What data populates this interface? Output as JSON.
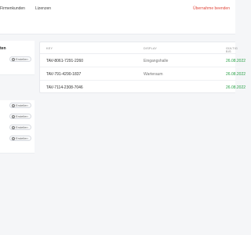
{
  "nav": {
    "firm_customers": "Firmenkunden",
    "licenses": "Lizenzen",
    "takeover": "Übernahme beenden"
  },
  "sidebar": {
    "title": "ten",
    "create_label": "Erstellen",
    "list_items": [
      {
        "label": "Erstellen"
      },
      {
        "label": "Erstellen"
      },
      {
        "label": "Erstellen"
      },
      {
        "label": "Erstellen"
      }
    ]
  },
  "table": {
    "headers": {
      "key": "KEY",
      "display": "DISPLAY",
      "valid": "GÜLTIG BIS"
    },
    "rows": [
      {
        "key": "TAV-8061-7291-2260",
        "display": "Eingangshalle",
        "valid": "26.08.2022"
      },
      {
        "key": "TAV-791-4290-1837",
        "display": "Warteraum",
        "valid": "26.08.2022"
      },
      {
        "key": "TAV-7114-2308-7046",
        "display": "",
        "valid": "26.08.2022"
      }
    ]
  },
  "colors": {
    "accent_red": "#e0483c",
    "date_green": "#2aa148",
    "background": "#f5f6f8"
  },
  "icons": {
    "create": "plus-circle-icon"
  }
}
